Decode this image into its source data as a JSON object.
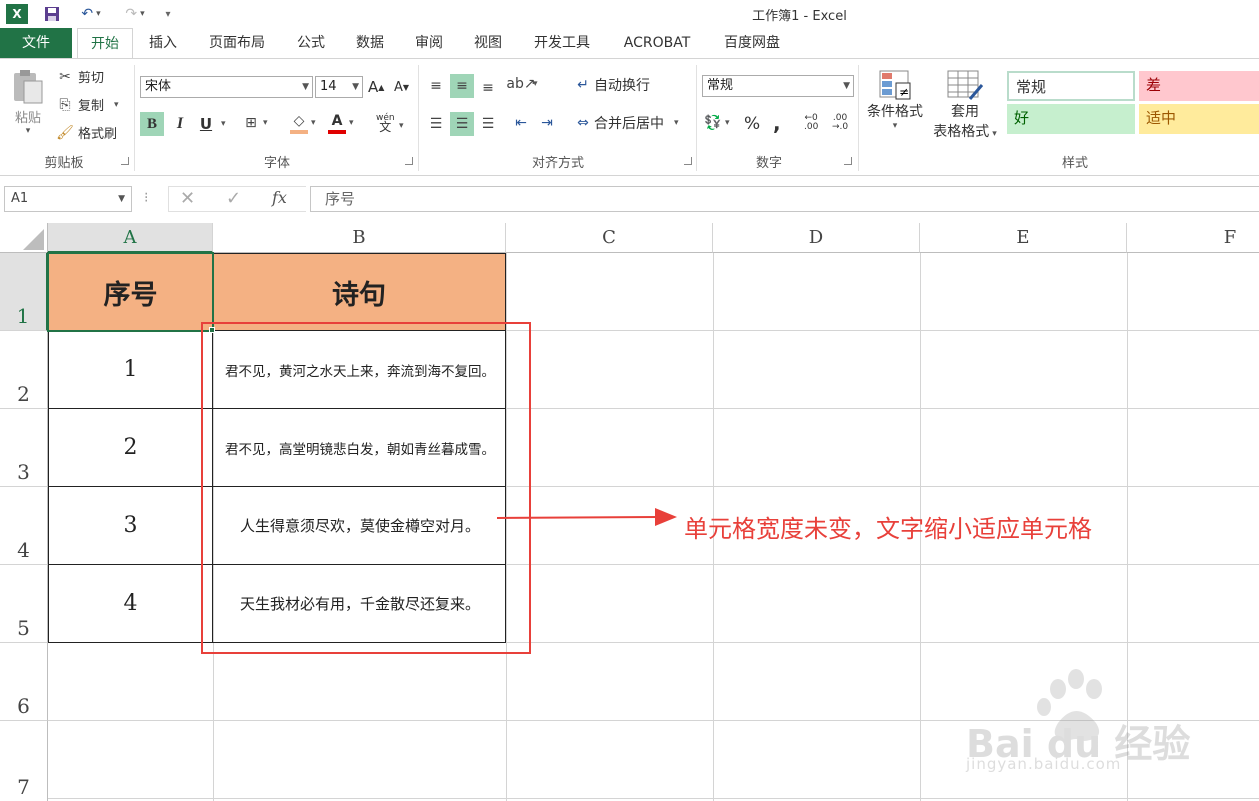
{
  "window": {
    "title": "工作簿1 - Excel"
  },
  "tabs": [
    "文件",
    "开始",
    "插入",
    "页面布局",
    "公式",
    "数据",
    "审阅",
    "视图",
    "开发工具",
    "ACROBAT",
    "百度网盘"
  ],
  "ribbon": {
    "clipboard": {
      "paste": "粘贴",
      "cut": "剪切",
      "copy": "复制",
      "format_painter": "格式刷",
      "label": "剪贴板"
    },
    "font": {
      "name": "宋体",
      "size": "14",
      "bold": "B",
      "italic": "I",
      "underline": "U",
      "label": "字体"
    },
    "alignment": {
      "wrap": "自动换行",
      "merge": "合并后居中",
      "label": "对齐方式"
    },
    "number": {
      "format": "常规",
      "percent": "%",
      "comma": ",",
      "label": "数字"
    },
    "styles": {
      "conditional_format": "条件格式",
      "table_format_line1": "套用",
      "table_format_line2": "表格格式",
      "normal": "常规",
      "bad": "差",
      "good": "好",
      "neutral": "适中",
      "label": "样式"
    }
  },
  "formula_bar": {
    "name_box": "A1",
    "fx": "fx",
    "content": "序号"
  },
  "columns": [
    "A",
    "B",
    "C",
    "D",
    "E",
    "F"
  ],
  "rows": [
    "1",
    "2",
    "3",
    "4",
    "5",
    "6",
    "7"
  ],
  "sheet": {
    "headers": [
      "序号",
      "诗句"
    ],
    "data": [
      {
        "num": "1",
        "poem": "君不见，黄河之水天上来，奔流到海不复回。"
      },
      {
        "num": "2",
        "poem": "君不见，高堂明镜悲白发，朝如青丝暮成雪。"
      },
      {
        "num": "3",
        "poem": "人生得意须尽欢，莫使金樽空对月。"
      },
      {
        "num": "4",
        "poem": "天生我材必有用，千金散尽还复来。"
      }
    ]
  },
  "annotation": {
    "text": "单元格宽度未变，文字缩小适应单元格",
    "color": "#e8403a"
  },
  "watermark": {
    "brand": "Bai du 经验",
    "url": "jingyan.baidu.com"
  },
  "colors": {
    "excel_green": "#217346",
    "header_fill": "#f4b183",
    "selected_button": "#9fd5b7"
  }
}
